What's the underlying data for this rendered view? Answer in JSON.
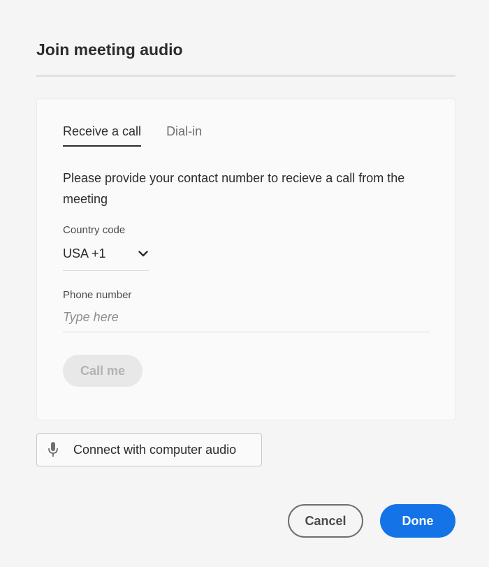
{
  "dialog": {
    "title": "Join meeting audio"
  },
  "tabs": [
    {
      "label": "Receive a call",
      "active": true
    },
    {
      "label": "Dial-in",
      "active": false
    }
  ],
  "receive_call": {
    "description": "Please provide your contact number to recieve a call from the meeting",
    "country_code": {
      "label": "Country code",
      "value": "USA +1"
    },
    "phone_number": {
      "label": "Phone number",
      "placeholder": "Type here",
      "value": ""
    },
    "call_button": "Call me"
  },
  "computer_audio_button": {
    "label": "Connect with computer audio",
    "icon": "microphone-icon"
  },
  "footer": {
    "cancel_label": "Cancel",
    "done_label": "Done"
  },
  "colors": {
    "accent": "#1473e6",
    "background": "#f5f5f5",
    "panel": "#fafafa"
  }
}
